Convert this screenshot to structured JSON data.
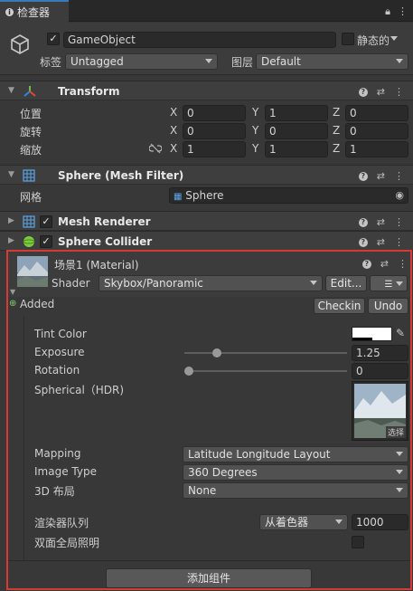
{
  "tab": {
    "title": "检查器"
  },
  "object": {
    "name": "GameObject",
    "static_label": "静态的",
    "tag_label": "标签",
    "tag_value": "Untagged",
    "layer_label": "图层",
    "layer_value": "Default"
  },
  "transform": {
    "title": "Transform",
    "position_label": "位置",
    "rotation_label": "旋转",
    "scale_label": "缩放",
    "axis_x": "X",
    "axis_y": "Y",
    "axis_z": "Z",
    "position": [
      "0",
      "1",
      "0"
    ],
    "rotation": [
      "0",
      "0",
      "0"
    ],
    "scale": [
      "1",
      "1",
      "1"
    ]
  },
  "mesh_filter": {
    "title": "Sphere (Mesh Filter)",
    "mesh_label": "网格",
    "mesh_value": "Sphere"
  },
  "mesh_renderer": {
    "title": "Mesh Renderer"
  },
  "sphere_collider": {
    "title": "Sphere Collider"
  },
  "material": {
    "name": "场景1 (Material)",
    "shader_label": "Shader",
    "shader_value": "Skybox/Panoramic",
    "edit_label": "Edit...",
    "added_label": "Added",
    "checkin_label": "Checkin",
    "undo_label": "Undo",
    "tint_label": "Tint Color",
    "exposure_label": "Exposure",
    "exposure_value": "1.25",
    "exposure_fraction": 0.18,
    "rotation_label": "Rotation",
    "rotation_value": "0",
    "rotation_fraction": 0,
    "spherical_label": "Spherical（HDR)",
    "select_label": "选择",
    "mapping_label": "Mapping",
    "mapping_value": "Latitude Longitude Layout",
    "image_type_label": "Image Type",
    "image_type_value": "360 Degrees",
    "layout_label": "3D 布局",
    "layout_value": "None",
    "queue_label": "渲染器队列",
    "queue_source": "从着色器",
    "queue_value": "1000",
    "gi_label": "双面全局照明"
  },
  "add_component_label": "添加组件",
  "colors": {
    "highlight": "#d63a35",
    "tab_accent": "#3a79bb"
  }
}
